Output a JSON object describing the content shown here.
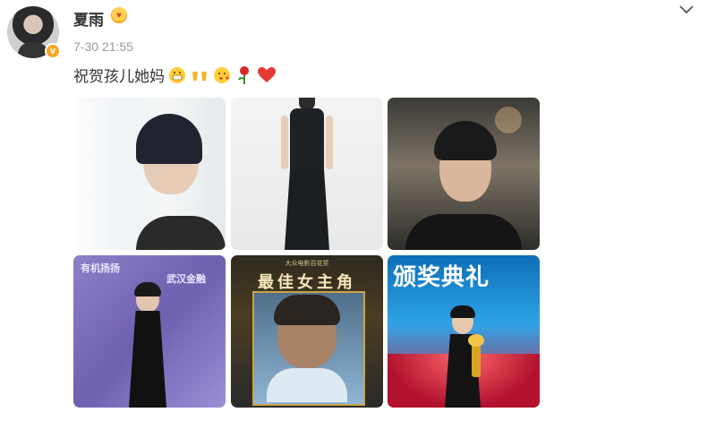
{
  "post": {
    "username": "夏雨",
    "timestamp": "7-30 21:55",
    "verified_badge": "v",
    "text": "祝贺孩儿她妈",
    "emojis": [
      "grin-emoji",
      "cheers-emoji",
      "love-face-emoji",
      "rose-emoji",
      "heart-emoji"
    ],
    "accent": "#f5a623"
  },
  "photos": {
    "poster_subtitle": "大众电影百花奖",
    "poster_title": "最佳女主角",
    "ceremony_title": "颁奖典礼",
    "wall_text_1": "有机扬扬",
    "wall_text_2": "武汉金融"
  }
}
